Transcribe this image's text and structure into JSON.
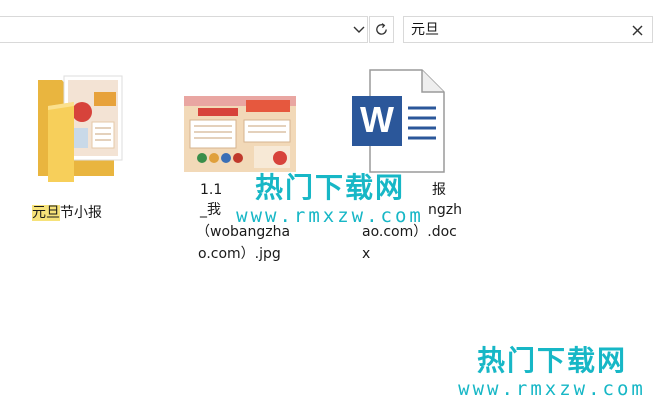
{
  "search": {
    "value": "元旦"
  },
  "files": [
    {
      "type": "folder",
      "name_highlight": "元旦",
      "name_rest": "节小报",
      "icon": "folder-icon"
    },
    {
      "type": "image",
      "name_lines": [
        "1.1",
        "_我",
        "（wobangzha",
        "o.com）.jpg"
      ],
      "icon": "image-thumbnail"
    },
    {
      "type": "document",
      "name_lines": [
        "报",
        "ngzh",
        "ao.com）.doc",
        "x"
      ],
      "icon": "word-document-icon",
      "icon_letter": "W"
    }
  ],
  "watermarks": [
    {
      "cn": "热门下载网",
      "en": "www.rmxzw.com"
    },
    {
      "cn": "热门下载网",
      "en": "www.rmxzw.com"
    }
  ],
  "colors": {
    "accent_word": "#2b579a",
    "folder": "#f7cf5a",
    "highlight": "#f6e27a",
    "watermark": "#17b7c6"
  }
}
